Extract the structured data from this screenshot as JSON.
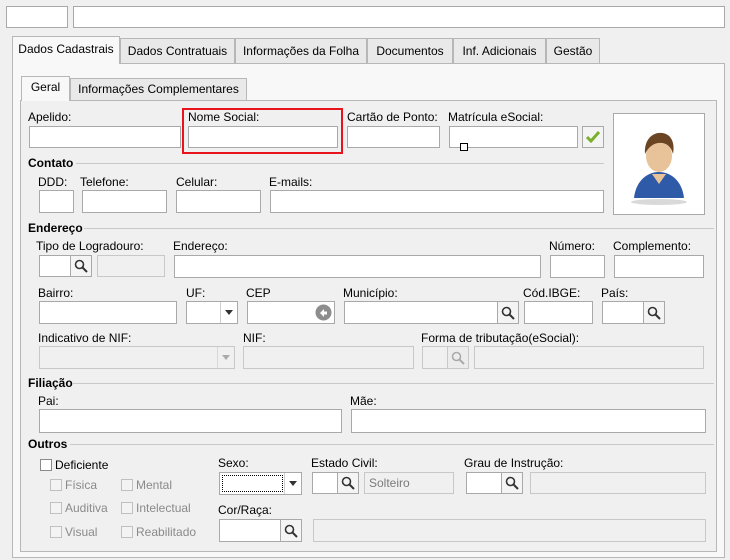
{
  "tabs": [
    "Dados Cadastrais",
    "Dados Contratuais",
    "Informações da Folha",
    "Documentos",
    "Inf. Adicionais",
    "Gestão"
  ],
  "subtabs": [
    "Geral",
    "Informações Complementares"
  ],
  "fields": {
    "apelido": "Apelido:",
    "nome_social": "Nome Social:",
    "cartao_ponto": "Cartão de Ponto:",
    "matricula_esocial": "Matrícula eSocial:"
  },
  "contato": {
    "title": "Contato",
    "ddd": "DDD:",
    "telefone": "Telefone:",
    "celular": "Celular:",
    "emails": "E-mails:"
  },
  "endereco": {
    "title": "Endereço",
    "tipo_logradouro": "Tipo de Logradouro:",
    "endereco": "Endereço:",
    "numero": "Número:",
    "complemento": "Complemento:",
    "bairro": "Bairro:",
    "uf": "UF:",
    "cep": "CEP",
    "municipio": "Município:",
    "cod_ibge": "Cód.IBGE:",
    "pais": "País:",
    "indicativo_nif": "Indicativo de NIF:",
    "nif": "NIF:",
    "forma_tributacao": "Forma de tributação(eSocial):"
  },
  "filiacao": {
    "title": "Filiação",
    "pai": "Pai:",
    "mae": "Mãe:"
  },
  "outros": {
    "title": "Outros",
    "deficiente": "Deficiente",
    "fisica": "Física",
    "mental": "Mental",
    "auditiva": "Auditiva",
    "intelectual": "Intelectual",
    "visual": "Visual",
    "reabilitado": "Reabilitado",
    "sexo": "Sexo:",
    "estado_civil": "Estado Civil:",
    "estado_civil_value": "Solteiro",
    "grau_instrucao": "Grau de Instrução:",
    "cor_raca": "Cor/Raça:"
  },
  "colors": {
    "highlight": "#e8141c",
    "check": "#7ab02c",
    "avatar_shirt": "#2f5aa8"
  }
}
